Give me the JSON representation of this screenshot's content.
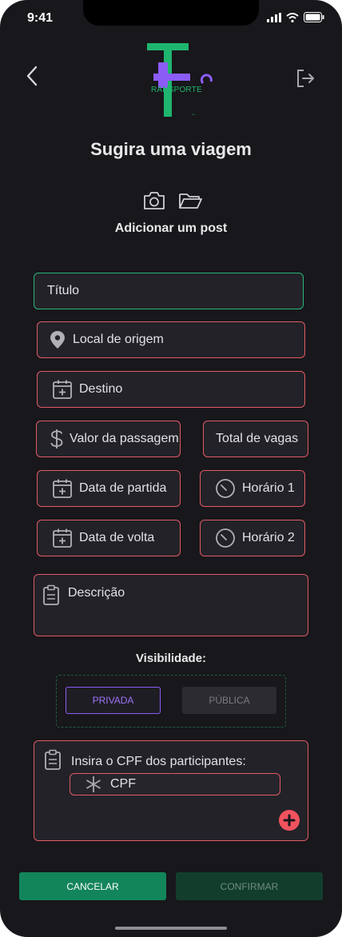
{
  "status_bar": {
    "time": "9:41"
  },
  "header": {
    "logo_text": "RANSPORTE",
    "title": "Sugira uma viagem",
    "subtitle": "Adicionar um post"
  },
  "form": {
    "titulo_placeholder": "Título",
    "origem_placeholder": "Local de origem",
    "destino_placeholder": "Destino",
    "valor_placeholder": "Valor da passagem",
    "vagas_placeholder": "Total de vagas",
    "partida_placeholder": "Data de partida",
    "horario1_placeholder": "Horário 1",
    "volta_placeholder": "Data de volta",
    "horario2_placeholder": "Horário 2",
    "descricao_placeholder": "Descrição"
  },
  "visibility": {
    "label": "Visibilidade:",
    "private_label": "PRIVADA",
    "public_label": "PÚBLICA",
    "selected": "PRIVADA"
  },
  "participants": {
    "label": "Insira o CPF dos participantes:",
    "cpf_placeholder": "CPF"
  },
  "actions": {
    "cancel_label": "CANCELAR",
    "confirm_label": "CONFIRMAR"
  },
  "colors": {
    "background": "#18171b",
    "field_border": "#e05a66",
    "focus_border": "#2ab57a",
    "accent_purple": "#8b5cf6",
    "primary_green": "#13855b",
    "add_button": "#f0525e"
  },
  "icons": [
    "back-arrow-icon",
    "logout-icon",
    "camera-icon",
    "folder-icon",
    "location-pin-icon",
    "calendar-icon",
    "dollar-icon",
    "clock-icon",
    "clipboard-icon",
    "asterisk-icon",
    "plus-icon"
  ]
}
